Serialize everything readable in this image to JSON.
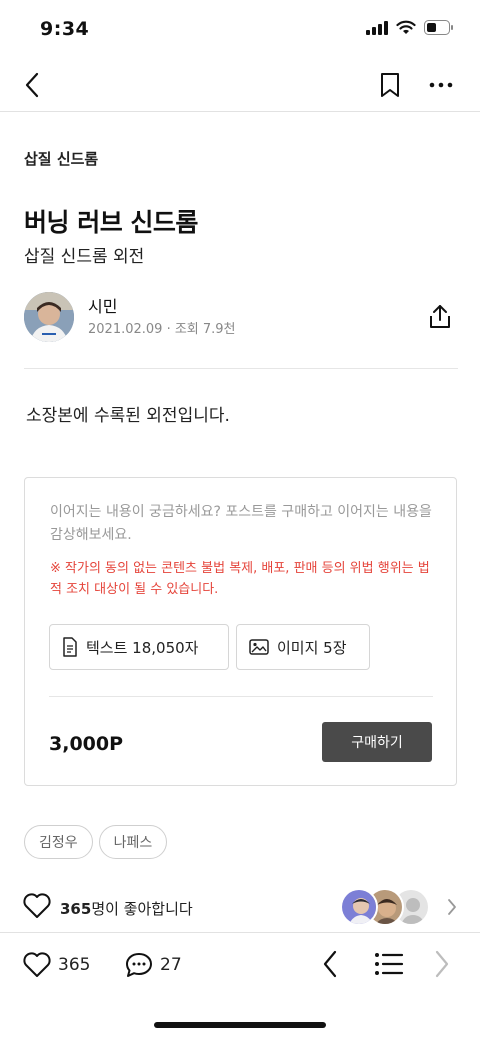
{
  "status_bar": {
    "time": "9:34"
  },
  "nav": {
    "back_icon": "chevron-left-icon",
    "bookmark_icon": "bookmark-icon",
    "more_icon": "more-horizontal-icon"
  },
  "post": {
    "series": "삽질 신드롬",
    "title": "버닝 러브 신드롬",
    "subtitle": "삽질 신드롬 외전",
    "author": {
      "name": "시민",
      "meta": "2021.02.09 · 조회 7.9천"
    },
    "body": "소장본에 수록된 외전입니다."
  },
  "paywall": {
    "description": "이어지는 내용이 궁금하세요? 포스트를 구매하고 이어지는 내용을 감상해보세요.",
    "warning": "※ 작가의 동의 없는 콘텐츠 불법 복제, 배포, 판매 등의 위법 행위는 법적 조치 대상이 될 수 있습니다.",
    "text_chip": "텍스트 18,050자",
    "image_chip": "이미지 5장",
    "price": "3,000P",
    "buy_label": "구매하기"
  },
  "tags": [
    "김정우",
    "나페스"
  ],
  "likes": {
    "count": "365",
    "suffix": "명이 좋아합니다"
  },
  "bottom_bar": {
    "like_count": "365",
    "comment_count": "27"
  },
  "colors": {
    "warning": "#e5453b",
    "buy_button": "#4a4a4a",
    "muted": "#999999"
  }
}
